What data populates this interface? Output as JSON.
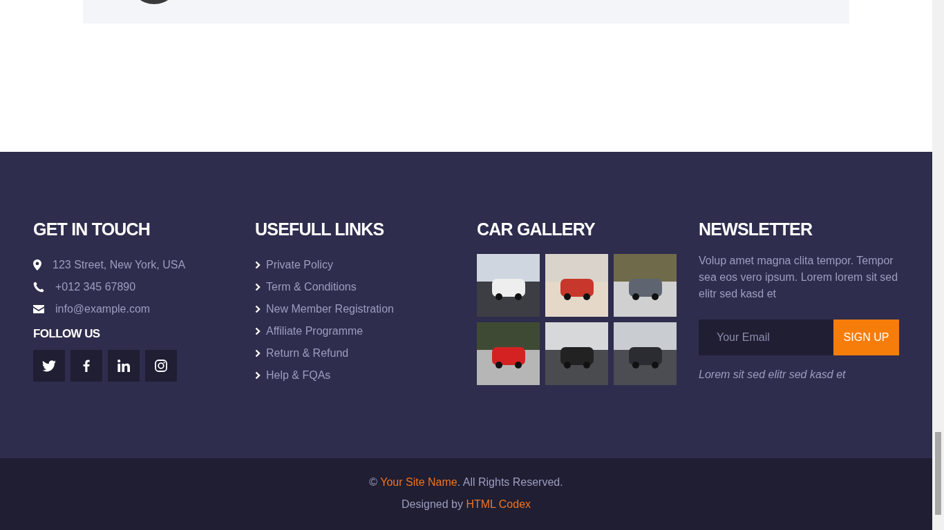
{
  "contact": {
    "heading": "GET IN TOUCH",
    "items": [
      {
        "kind": "address",
        "text": "123 Street, New York, USA"
      },
      {
        "kind": "phone",
        "text": "+012 345 67890"
      },
      {
        "kind": "email",
        "text": "info@example.com"
      }
    ]
  },
  "follow": {
    "heading": "FOLLOW US",
    "socials": [
      {
        "kind": "twitter"
      },
      {
        "kind": "facebook"
      },
      {
        "kind": "linkedin"
      },
      {
        "kind": "instagram"
      }
    ]
  },
  "links": {
    "heading": "USEFULL LINKS",
    "items": [
      "Private Policy",
      "Term & Conditions",
      "New Member Registration",
      "Affiliate Programme",
      "Return & Refund",
      "Help & FQAs"
    ]
  },
  "gallery": {
    "heading": "CAR GALLERY"
  },
  "newsletter": {
    "heading": "NEWSLETTER",
    "text": "Volup amet magna clita tempor. Tempor sea eos vero ipsum. Lorem lorem sit sed elitr sed kasd et",
    "placeholder": "Your Email",
    "button": "SIGN UP",
    "note": "Lorem sit sed elitr sed kasd et"
  },
  "copyright": {
    "prefix": "©",
    "site_name": "Your Site Name",
    "suffix": ". All Rights Reserved.",
    "designed_prefix": "Designed by",
    "designer": "HTML Codex"
  }
}
